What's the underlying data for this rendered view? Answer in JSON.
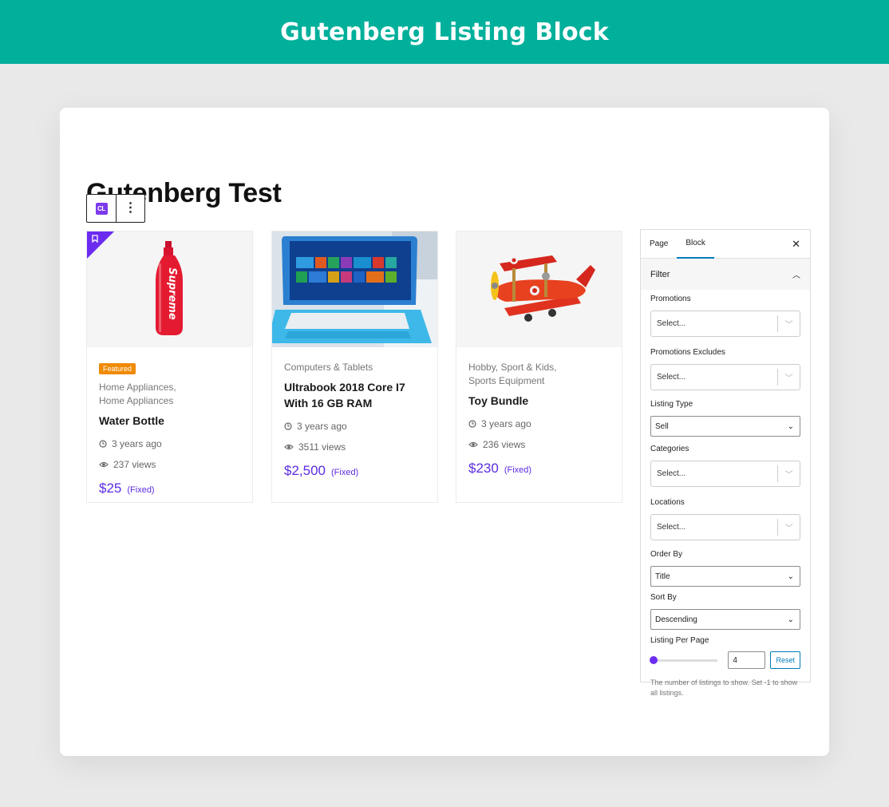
{
  "banner": {
    "title": "Gutenberg Listing Block"
  },
  "editor": {
    "page_title": "Gutenberg Test",
    "toolbar": {
      "block_icon": "classified-listing-logo-icon",
      "block_icon_text": "CL",
      "options_icon": "more-vertical-icon"
    }
  },
  "listings": [
    {
      "featured": true,
      "featured_label": "Featured",
      "cat1": "Home Appliances,",
      "cat2": "Home Appliances",
      "title": "Water Bottle",
      "posted": "3 years ago",
      "views": "237 views",
      "price": "$25",
      "price_type": "(Fixed)",
      "bottle_text": "Supreme"
    },
    {
      "featured": false,
      "cat1": "Computers & Tablets",
      "cat2": "",
      "title": "Ultrabook 2018 Core I7 With 16 GB RAM",
      "posted": "3 years ago",
      "views": "3511 views",
      "price": "$2,500",
      "price_type": "(Fixed)"
    },
    {
      "featured": false,
      "cat1": "Hobby, Sport & Kids,",
      "cat2": "Sports Equipment",
      "title": "Toy Bundle",
      "posted": "3 years ago",
      "views": "236 views",
      "price": "$230",
      "price_type": "(Fixed)"
    }
  ],
  "sidebar": {
    "tabs": [
      {
        "label": "Page",
        "active": false
      },
      {
        "label": "Block",
        "active": true
      }
    ],
    "close_icon": "close-icon",
    "panel_title": "Filter",
    "fields": {
      "promotions": {
        "label": "Promotions",
        "value": "Select..."
      },
      "promotions_excludes": {
        "label": "Promotions Excludes",
        "value": "Select..."
      },
      "listing_type": {
        "label": "Listing Type",
        "value": "Sell"
      },
      "categories": {
        "label": "Categories",
        "value": "Select..."
      },
      "locations": {
        "label": "Locations",
        "value": "Select..."
      },
      "order_by": {
        "label": "Order By",
        "value": "Title"
      },
      "sort_by": {
        "label": "Sort By",
        "value": "Descending"
      },
      "per_page": {
        "label": "Listing Per Page",
        "value": "4",
        "reset_label": "Reset",
        "slider_fraction": 0.0
      }
    },
    "help_text": "The number of listings to show. Set -1 to show all listings."
  },
  "colors": {
    "banner": "#00b09b",
    "accent": "#5b2be0",
    "featured_badge": "#f08a05",
    "wp_blue": "#007cba"
  }
}
